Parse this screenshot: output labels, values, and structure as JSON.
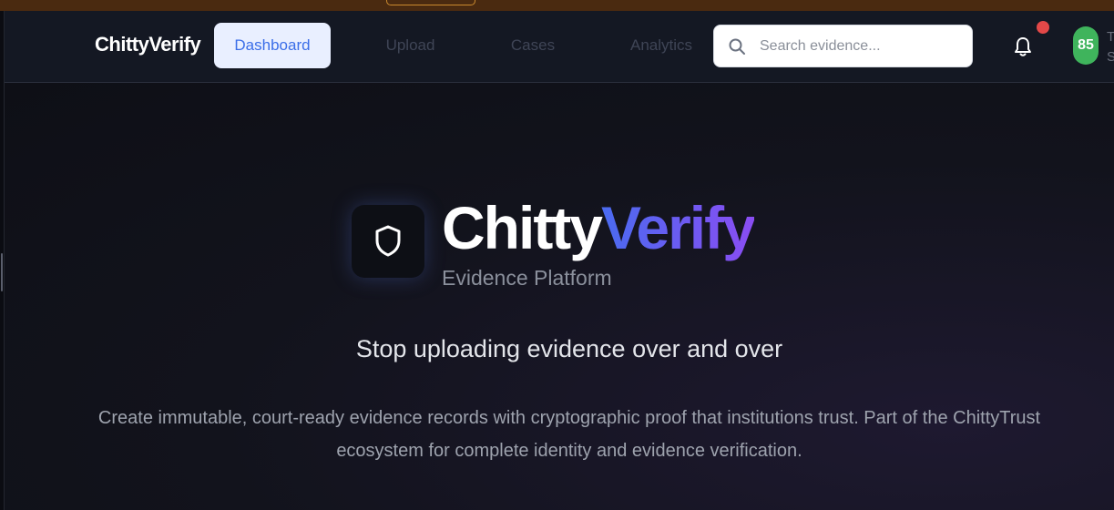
{
  "brand": "ChittyVerify",
  "nav": {
    "items": [
      {
        "label": "Dashboard",
        "active": true
      },
      {
        "label": "Upload",
        "active": false
      },
      {
        "label": "Cases",
        "active": false
      },
      {
        "label": "Analytics",
        "active": false
      }
    ]
  },
  "search": {
    "placeholder": "Search evidence...",
    "icon": "search-icon"
  },
  "notifications": {
    "icon": "bell-icon",
    "has_unread": true
  },
  "profile": {
    "trust_score": "85",
    "label_fragment": "T S"
  },
  "hero": {
    "title_main": "Chitty",
    "title_accent": "Verify",
    "subtitle": "Evidence Platform",
    "logo_icon": "shield-icon",
    "tagline": "Stop uploading evidence over and over",
    "description": "Create immutable, court-ready evidence records with cryptographic proof that institutions trust. Part of the ChittyTrust ecosystem for complete identity and evidence verification."
  },
  "colors": {
    "accent_blue": "#3b6ee8",
    "gradient_start": "#4a6bf0",
    "gradient_end": "#8a4df2",
    "score_green": "#3fb45c",
    "notification_red": "#e34848"
  }
}
